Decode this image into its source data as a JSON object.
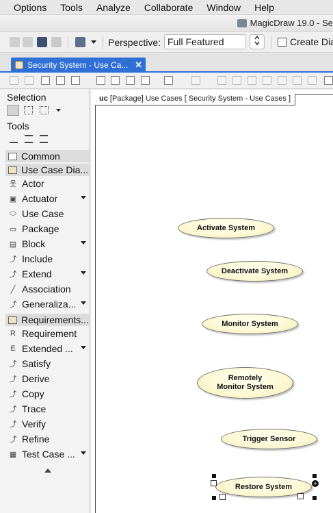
{
  "menu": {
    "items": [
      "Options",
      "Tools",
      "Analyze",
      "Collaborate",
      "Window",
      "Help"
    ]
  },
  "window": {
    "app_title": "MagicDraw 19.0 - Se"
  },
  "toolbar": {
    "perspective_label": "Perspective:",
    "perspective_value": "Full Featured",
    "create_diagram_label": "Create Dia"
  },
  "tab": {
    "label": "Security System - Use Ca...",
    "close": "✕"
  },
  "palette": {
    "selection_label": "Selection",
    "tools_label": "Tools",
    "groups": {
      "common": "Common",
      "use_case": "Use Case Dia...",
      "requirements": "Requirements..."
    },
    "use_case_items": [
      {
        "label": "Actor",
        "icon": "actor-icon",
        "has_menu": false
      },
      {
        "label": "Actuator",
        "icon": "actuator-icon",
        "has_menu": true
      },
      {
        "label": "Use Case",
        "icon": "use-case-icon",
        "has_menu": false
      },
      {
        "label": "Package",
        "icon": "package-icon",
        "has_menu": false
      },
      {
        "label": "Block",
        "icon": "block-icon",
        "has_menu": true
      },
      {
        "label": "Include",
        "icon": "include-icon",
        "has_menu": false
      },
      {
        "label": "Extend",
        "icon": "extend-icon",
        "has_menu": true
      },
      {
        "label": "Association",
        "icon": "association-icon",
        "has_menu": false
      },
      {
        "label": "Generaliza...",
        "icon": "generalization-icon",
        "has_menu": true
      }
    ],
    "requirement_items": [
      {
        "label": "Requirement",
        "icon": "requirement-icon",
        "has_menu": false
      },
      {
        "label": "Extended ...",
        "icon": "extended-requirement-icon",
        "has_menu": true
      },
      {
        "label": "Satisfy",
        "icon": "satisfy-icon",
        "has_menu": false
      },
      {
        "label": "Derive",
        "icon": "derive-icon",
        "has_menu": false
      },
      {
        "label": "Copy",
        "icon": "copy-icon",
        "has_menu": false
      },
      {
        "label": "Trace",
        "icon": "trace-icon",
        "has_menu": false
      },
      {
        "label": "Verify",
        "icon": "verify-icon",
        "has_menu": false
      },
      {
        "label": "Refine",
        "icon": "refine-icon",
        "has_menu": false
      },
      {
        "label": "Test Case ...",
        "icon": "test-case-icon",
        "has_menu": true
      }
    ]
  },
  "diagram": {
    "frame_kind": "uc",
    "frame_title": "[Package] Use Cases [ Security System - Use Cases ]",
    "use_cases": [
      {
        "label": "Activate System"
      },
      {
        "label": "Deactivate System"
      },
      {
        "label": "Monitor System"
      },
      {
        "label": "Remotely\nMonitor System"
      },
      {
        "label": "Trigger Sensor"
      },
      {
        "label": "Restore System"
      }
    ]
  },
  "colors": {
    "accent": "#2f6fd6",
    "use_case_fill": "#fdf9d6",
    "palette_group_bg": "#dcdcdc"
  }
}
